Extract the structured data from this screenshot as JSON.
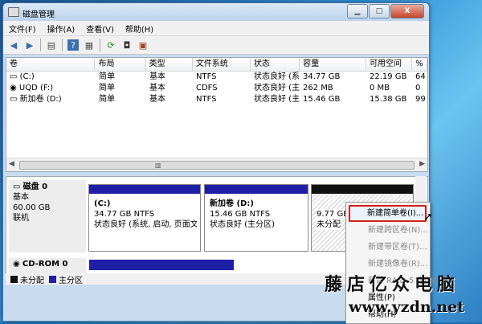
{
  "window": {
    "title": "磁盘管理",
    "min": "▁",
    "max": "□",
    "close": "X"
  },
  "menu": [
    "文件(F)",
    "操作(A)",
    "查看(V)",
    "帮助(H)"
  ],
  "volume_list": {
    "columns": [
      "卷",
      "布局",
      "类型",
      "文件系统",
      "状态",
      "容量",
      "可用空间",
      "%"
    ],
    "rows": [
      [
        "(C:)",
        "简单",
        "基本",
        "NTFS",
        "状态良好 (系...",
        "34.77 GB",
        "22.19 GB",
        "64"
      ],
      [
        "UQD (F:)",
        "简单",
        "基本",
        "CDFS",
        "状态良好 (主...",
        "262 MB",
        "0 MB",
        "0"
      ],
      [
        "新加卷 (D:)",
        "简单",
        "基本",
        "NTFS",
        "状态良好 (主...",
        "15.46 GB",
        "15.38 GB",
        "99"
      ]
    ]
  },
  "disk0": {
    "name": "磁盘 0",
    "type": "基本",
    "size": "60.00 GB",
    "status": "联机",
    "partitions": [
      {
        "name": "(C:)",
        "size": "34.77 GB NTFS",
        "status": "状态良好 (系统, 启动, 页面文件"
      },
      {
        "name": "新加卷  (D:)",
        "size": "15.46 GB NTFS",
        "status": "状态良好 (主分区)"
      },
      {
        "name": "",
        "size": "9.77 GB",
        "status": "未分配"
      }
    ]
  },
  "cdrom": {
    "name": "CD-ROM 0"
  },
  "legend": {
    "unallocated": "未分配",
    "primary": "主分区"
  },
  "context_menu": {
    "items": [
      {
        "label": "新建简单卷(I)...",
        "enabled": true
      },
      {
        "label": "新建跨区卷(N)...",
        "enabled": false
      },
      {
        "label": "新建带区卷(T)...",
        "enabled": false
      },
      {
        "label": "新建镜像卷(R)...",
        "enabled": false
      },
      {
        "label": "新建 RAID-5 卷(W)...",
        "enabled": false
      },
      {
        "label": "属性(P)",
        "enabled": true
      },
      {
        "label": "帮助(H)",
        "enabled": true
      }
    ]
  },
  "watermark": {
    "line1": "藤店亿众电脑",
    "line2": "www.yzdn.net"
  },
  "colors": {
    "primary_partition": "#1f1fa5",
    "unallocated": "#111111",
    "highlight_border": "#d42020"
  }
}
